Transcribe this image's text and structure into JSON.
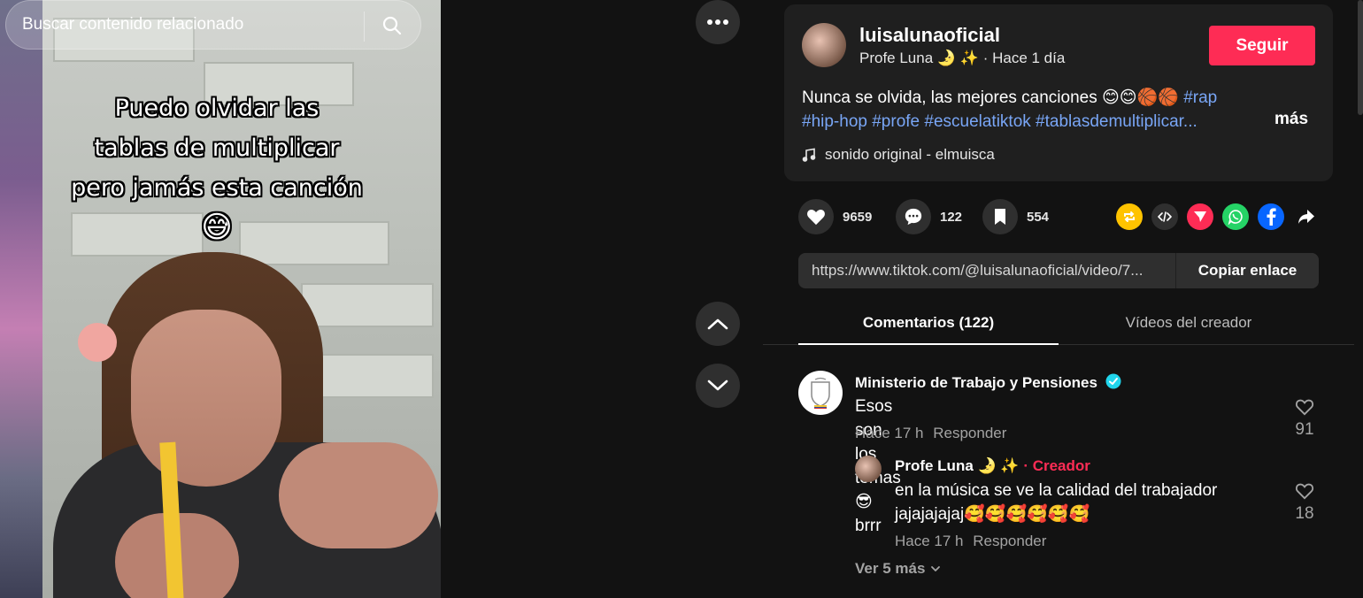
{
  "search": {
    "placeholder": "Buscar contenido relacionado"
  },
  "video": {
    "overlay_lines": [
      "Puedo olvidar las",
      "tablas de multiplicar",
      "pero jamás esta canción"
    ],
    "overlay_emoji": "😅"
  },
  "post": {
    "username": "luisalunaoficial",
    "display_name": "Profe Luna 🌛 ✨",
    "time": "· Hace 1 día",
    "follow_label": "Seguir",
    "description_text": "Nunca se olvida, las mejores canciones 😊😊🏀🏀 ",
    "hashtags_line1": "#rap",
    "hashtags_line2": "#hip-hop #profe #escuelatiktok #tablasdemultiplicar...",
    "more_label": "más",
    "music": "sonido original - elmuisca"
  },
  "actions": {
    "likes": "9659",
    "comments": "122",
    "saves": "554"
  },
  "link": {
    "url": "https://www.tiktok.com/@luisalunaoficial/video/7...",
    "copy_label": "Copiar enlace"
  },
  "tabs": {
    "comments": "Comentarios (122)",
    "creator_videos": "Vídeos del creador"
  },
  "comments": [
    {
      "author": "Ministerio de Trabajo y Pensiones",
      "text": "Esos son los temas 😎 brrr",
      "time": "Hace 17 h",
      "reply_label": "Responder",
      "likes": "91",
      "replies": [
        {
          "author": "Profe Luna 🌛 ✨",
          "badge": "· Creador",
          "text_line1": "en la música se ve la calidad del trabajador",
          "text_line2": "jajajajajaj🥰🥰🥰🥰🥰🥰",
          "time": "Hace 17 h",
          "reply_label": "Responder",
          "likes": "18"
        }
      ]
    }
  ],
  "view_more": "Ver 5 más",
  "colors": {
    "accent": "#fe2c55",
    "hashtag": "#79a6f6",
    "background": "#121212",
    "card": "#1f1f1f"
  }
}
